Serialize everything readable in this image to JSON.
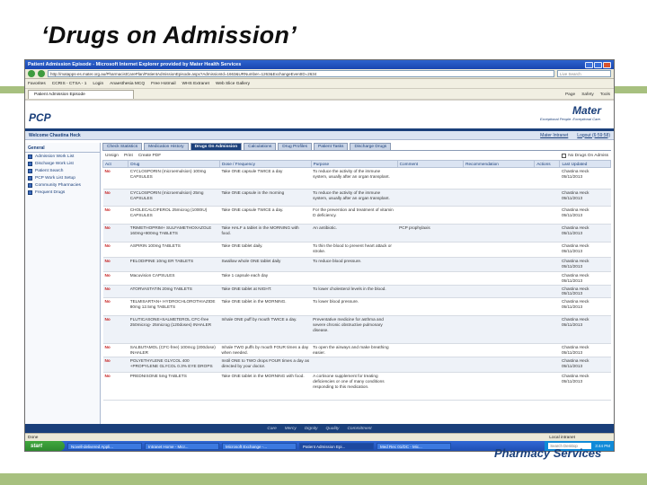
{
  "slide": {
    "title": "‘Drugs on Admission’",
    "footer_brand": "Pharmacy Services"
  },
  "browser": {
    "window_title": "Patient Admission Episode - Microsoft Internet Explorer provided by Mater Health Services",
    "url": "http://matapps-es.mater.org.au/PharmacistCarePlan/PatientAdmissionEpisode.aspx?AdmissionId=1663&URNumber=1263&ExchangeEventID=2634",
    "search_placeholder": "Live Search",
    "favorites": [
      "Favorites",
      "CCRIS - CTSA - 1",
      "Login",
      "Anaesthesia MCQ",
      "Free Hotmail",
      "WHS Extranet",
      "Web Slice Gallery"
    ],
    "tab_label": "Patient Admission Episode",
    "tab_tools": [
      "Page",
      "Safety",
      "Tools"
    ],
    "status_text": "Done",
    "status_zone": "Local intranet"
  },
  "app": {
    "name": "PCP",
    "logo_name": "Mater",
    "logo_tagline": "Exceptional People. Exceptional Care.",
    "welcome": "Welcome Chastina Heck",
    "header_links": [
      "Mater Intranet",
      "Logout (6:59:58)"
    ]
  },
  "sidebar": {
    "heading": "General",
    "items": [
      "Admission Work List",
      "Discharge Work List",
      "Patient Search",
      "PCP Work List Setup",
      "Community Pharmacies",
      "Frequent Drugs"
    ]
  },
  "page_tabs": {
    "items": [
      "Check Statistics",
      "Medication History",
      "Drugs On Admission",
      "Calculations",
      "Drug Profiles",
      "Patient Tasks",
      "Discharge Drugs"
    ],
    "active_index": 2
  },
  "toolbar": {
    "actions": [
      "Unsign",
      "Print",
      "Create PDF"
    ],
    "no_drugs_label": "No Drugs On Admiss"
  },
  "table": {
    "headers": [
      "Act",
      "Drug",
      "Dose / Frequency",
      "Purpose",
      "Comment",
      "Recommendation",
      "Actions",
      "Last Updated"
    ],
    "rows": [
      {
        "act": "No",
        "drug": "CYCLOSPORIN (microemulsion) 100mg CAPSULES",
        "dose": "Take ONE capsule TWICE a day",
        "purpose": "To reduce the activity of the immune system, usually after an organ transplant.",
        "comment": "",
        "updated": "Chastina Heck 05/11/2013"
      },
      {
        "act": "No",
        "drug": "CYCLOSPORIN (microemulsion) 25mg CAPSULES",
        "dose": "Take ONE capsule in the morning",
        "purpose": "To reduce the activity of the immune system, usually after an organ transplant.",
        "comment": "",
        "updated": "Chastina Heck 05/11/2013"
      },
      {
        "act": "No",
        "drug": "CHOLECALCIFEROL 25microg (1000IU) CAPSULES",
        "dose": "Take ONE capsule TWICE a day.",
        "purpose": "For the prevention and treatment of vitamin D deficiency.",
        "comment": "",
        "updated": "Chastina Heck 05/11/2013"
      },
      {
        "act": "No",
        "drug": "TRIMETHOPRIM+ SULFAMETHOXAZOLE 160mg+800mg TABLETS",
        "dose": "Take HALF a tablet in the MORNING with food.",
        "purpose": "An antibiotic.",
        "comment": "PCP prophylaxis",
        "updated": "Chastina Heck 05/11/2013"
      },
      {
        "act": "No",
        "drug": "ASPIRIN 100mg TABLETS",
        "dose": "Take ONE tablet daily.",
        "purpose": "To thin the blood to prevent heart attack or stroke.",
        "comment": "",
        "updated": "Chastina Heck 05/11/2013"
      },
      {
        "act": "No",
        "drug": "FELODIPINE 10mg ER TABLETS",
        "dose": "Swallow whole ONE tablet daily",
        "purpose": "To reduce blood pressure.",
        "comment": "",
        "updated": "Chastina Heck 05/11/2013"
      },
      {
        "act": "No",
        "drug": "Macuvision CAPSULES",
        "dose": "Take 1 capsule each day",
        "purpose": "",
        "comment": "",
        "updated": "Chastina Heck 05/11/2013"
      },
      {
        "act": "No",
        "drug": "ATORVASTATIN 20mg TABLETS",
        "dose": "Take ONE tablet at NIGHT.",
        "purpose": "To lower cholesterol levels in the blood.",
        "comment": "",
        "updated": "Chastina Heck 05/11/2013"
      },
      {
        "act": "No",
        "drug": "TELMISARTAN+ HYDROCHLOROTHIAZIDE 80mg 12.5mg TABLETS",
        "dose": "Take ONE tablet in the MORNING.",
        "purpose": "To lower blood pressure.",
        "comment": "",
        "updated": "Chastina Heck 05/11/2013"
      },
      {
        "act": "No",
        "drug": "FLUTICASONE+SALMETEROL CFC-free 250microg- 25microg (120doses) INHALER",
        "dose": "Inhale ONE puff by mouth TWICE a day.",
        "purpose": "Preventative medicine for asthma and severe chronic obstructive pulmonary disease.",
        "comment": "",
        "updated": "Chastina Heck 05/11/2013"
      },
      {
        "act": "No",
        "drug": "SALBUTAMOL (CFC-free) 100mcg (200dose) INHALER",
        "dose": "Inhale TWO puffs by mouth FOUR times a day when needed.",
        "purpose": "To open the airways and make breathing easier.",
        "comment": "",
        "updated": "Chastina Heck 05/11/2013"
      },
      {
        "act": "No",
        "drug": "POLYETHYLENE GLYCOL 400 +PROPYLENE GLYCOL 0.3% EYE DROPS",
        "dose": "Instil ONE to TWO drops FOUR times a day as directed by your doctor.",
        "purpose": "",
        "comment": "",
        "updated": "Chastina Heck 05/11/2013"
      },
      {
        "act": "No",
        "drug": "PREDNISONE 5mg TABLETS",
        "dose": "Take ONE tablet in the MORNING with food.",
        "purpose": "A cortisone supplement for treating deficiencies or one of many conditions responding to this medication.",
        "comment": "",
        "updated": "Chastina Heck 05/11/2013"
      }
    ]
  },
  "footer_links": [
    "Care",
    "Mercy",
    "Dignity",
    "Quality",
    "Commitment"
  ],
  "taskbar": {
    "start": "start",
    "items": [
      "Novell-delivered Appli...",
      "Intranet Home - Micr...",
      "Microsoft Exchange -...",
      "Patient Admission Epi...",
      "Med Rec 01/DC - Mic..."
    ],
    "active_index": 3,
    "tray_search": "Search Desktop",
    "clock": "3:44 PM"
  }
}
